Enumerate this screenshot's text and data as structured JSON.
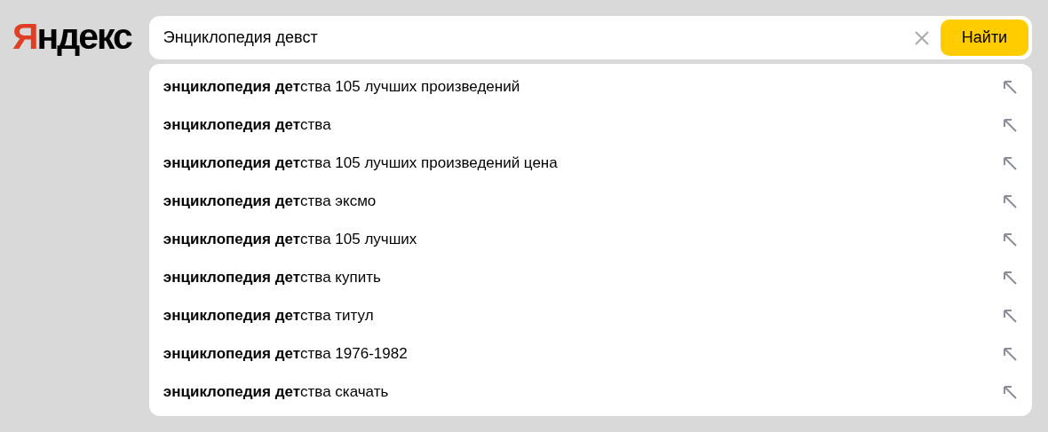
{
  "logo": {
    "text": "Яндекс"
  },
  "search": {
    "value": "Энциклопедия девст",
    "button": "Найти"
  },
  "suggestions": [
    {
      "text": "**энциклопедия дет**ства 105 лучших произведений"
    },
    {
      "text": "**энциклопедия дет**ства"
    },
    {
      "text": "**энциклопедия дет**ства 105 лучших произведений цена"
    },
    {
      "text": "**энциклопедия дет**ства эксмо"
    },
    {
      "text": "**энциклопедия дет**ства 105 лучших"
    },
    {
      "text": "**энциклопедия дет**ства купить"
    },
    {
      "text": "**энциклопедия дет**ства титул"
    },
    {
      "text": "**энциклопедия дет**ства 1976-1982"
    },
    {
      "text": "**энциклопедия дет**ства скачать"
    }
  ]
}
